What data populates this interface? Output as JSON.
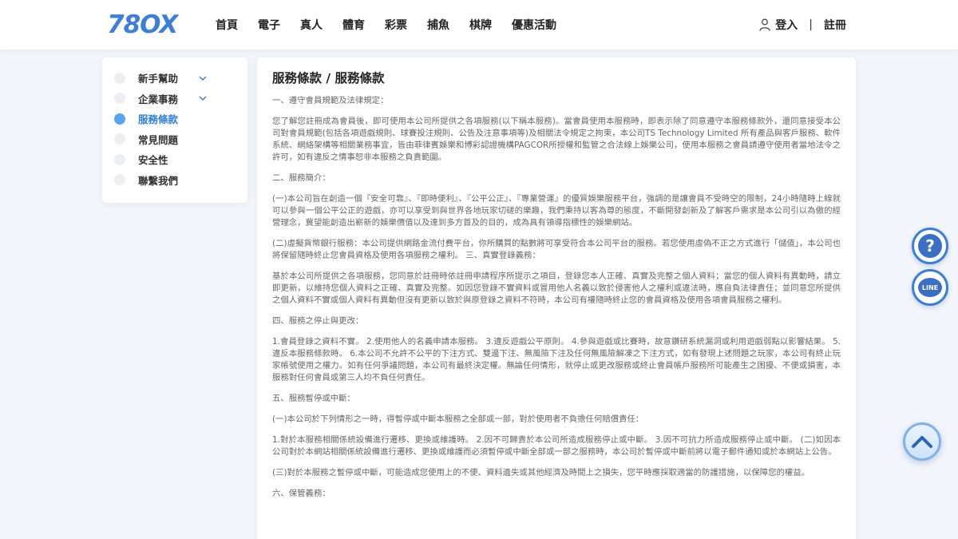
{
  "header": {
    "logo_text": "78OX",
    "nav": [
      "首頁",
      "電子",
      "真人",
      "體育",
      "彩票",
      "捕魚",
      "棋牌",
      "優惠活動"
    ],
    "login": "登入",
    "separator": "|",
    "register": "註冊"
  },
  "sidebar": {
    "items": [
      {
        "label": "新手幫助",
        "expandable": true,
        "active": false
      },
      {
        "label": "企業事務",
        "expandable": true,
        "active": false
      },
      {
        "label": "服務條款",
        "expandable": false,
        "active": true
      },
      {
        "label": "常見問題",
        "expandable": false,
        "active": false
      },
      {
        "label": "安全性",
        "expandable": false,
        "active": false
      },
      {
        "label": "聯繫我們",
        "expandable": false,
        "active": false
      }
    ]
  },
  "main": {
    "title": "服務條款 / 服務條款",
    "paragraphs": [
      "一、遵守會員規範及法律規定：",
      "您了解您註冊成為會員後，即可使用本公司所提供之各項服務(以下稱本服務)。當會員使用本服務時，即表示除了同意遵守本服務條款外，還同意接受本公司對會員規範(包括各項遊戲規則、球賽投注規則、公告及注意事項等)及相關法令規定之拘束，本公司TS Technology Limited 所有產品與客戶服務、軟件系統、網絡架構等相關業務事宜，皆由菲律賓娛樂和博彩認證機構PAGCOR所授權和監管之合法線上娛樂公司，使用本服務之會員請遵守使用者當地法令之許可，如有違反之情事恕非本服務之負責範圍。",
      "二、服務簡介：",
      "(一)本公司旨在創造一個『安全可靠』、『即時便利』、『公平公正』、『專業營運』的優質娛樂服務平台，強調的是讓會員不受時空的限制，24小時隨時上線就可以參與一個公平公正的遊戲，亦可以享受到與世界各地玩家切磋的樂趣，我們秉持以客為尊的態度，不斷開發創新及了解客戶需求是本公司引以為傲的經營理念，冀望能創造出嶄新的娛樂價值以及達到多方首及的目的，成為具有領導指標性的娛樂網站。",
      "(二)虛擬貨幣銀行服務：本公司提供網路金流付費平台，你所購買的點數將可享受符合本公司平台的服務。若您使用虛偽不正之方式進行「儲值」，本公司也將保留隨時終止您會員資格及使用各項服務之權利。 三、真實登錄義務：",
      "基於本公司所提供之各項服務，您同意於註冊時依註冊申請程序所提示之項目，登錄您本人正確、真實及完整之個人資料；當您的個人資料有異動時，請立即更新，以維持您個人資料之正確、真實及完整。如因您登錄不實資料或冒用他人名義以致於侵害他人之權利或違法時，應自負法律責任；並同意您所提供之個人資料不實或個人資料有異動但沒有更新以致於與原登錄之資料不符時，本公司有權隨時終止您的會員資格及使用各項會員服務之權利。",
      "四、服務之停止與更改：",
      "1.會員登錄之資料不實。 2.使用他人的名義申請本服務。 3.違反遊戲公平原則。 4.參與遊戲或比賽時，故意鑽研系統漏洞或利用遊戲弱點以影響結果。 5.違反本服務條款時。 6.本公司不允許不公平的下注方式、雙邊下注、無風險下注及任何無風險解凍之下注方式，如有發現上述問題之玩家，本公司有終止玩家帳號使用之權力。如有任何爭議問題，本公司有最終決定權。無論任何情形，就停止或更改服務或終止會員帳戶服務所可能產生之困擾、不便或損害，本服務對任何會員或第三人均不負任何責任。",
      "五、服務暫停或中斷：",
      "(一)本公司於下列情形之一時，得暫停或中斷本服務之全部或一部，對於使用者不負擔任何賠償責任：",
      "1.對於本服務相關係統設備進行遷移、更換或維護時。 2.因不可歸責於本公司所造成服務停止或中斷。 3.因不可抗力所造成服務停止或中斷。 (二)如因本公司對於本網站相關係統設備進行遷移、更換或維護而必須暫停或中斷全部或一部之服務時，本公司於暫停或中斷前將以電子郵件通知或於本網站上公告。",
      "(三)對於本服務之暫停或中斷，可能造成您使用上的不便、資料遺失或其他經濟及時間上之損失，您平時應採取適當的防護措施，以保障您的權益。",
      "六、保管義務："
    ]
  },
  "floating": {
    "help_label": "?",
    "line_label": "LINE"
  },
  "colors": {
    "brand_blue": "#3d7fd6",
    "active_blue": "#2f7ed8",
    "page_bg": "#f2f5fa"
  }
}
